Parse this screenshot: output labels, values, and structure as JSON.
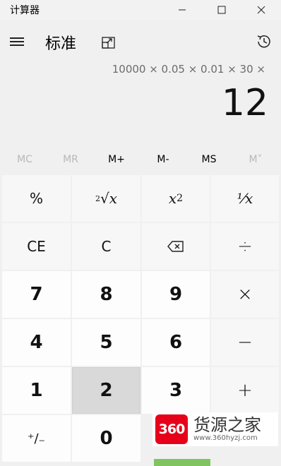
{
  "window": {
    "title": "计算器",
    "controls": {
      "minimize_icon": "minimize-icon",
      "maximize_icon": "maximize-icon",
      "close_icon": "close-icon"
    }
  },
  "header": {
    "menu_icon": "hamburger-icon",
    "mode": "标准",
    "keep_on_top_icon": "keep-on-top-icon",
    "history_icon": "history-icon"
  },
  "display": {
    "expression": "10000 × 0.05 × 0.01 × 30 ×",
    "result": "12"
  },
  "memory": [
    {
      "label": "MC",
      "enabled": false
    },
    {
      "label": "MR",
      "enabled": false
    },
    {
      "label": "M+",
      "enabled": true
    },
    {
      "label": "M-",
      "enabled": true
    },
    {
      "label": "MS",
      "enabled": true
    },
    {
      "label": "M˅",
      "enabled": false
    }
  ],
  "keys": {
    "percent": "%",
    "sqrt_index": "2",
    "sqrt_var": "x",
    "square_base": "x",
    "square_exp": "2",
    "reciprocal": "⅟x",
    "ce": "CE",
    "c": "C",
    "backspace_icon": "backspace-icon",
    "divide": "÷",
    "n7": "7",
    "n8": "8",
    "n9": "9",
    "multiply": "×",
    "n4": "4",
    "n5": "5",
    "n6": "6",
    "minus": "−",
    "n1": "1",
    "n2": "2",
    "n3": "3",
    "plus": "+",
    "negate": "⁺∕₋",
    "n0": "0"
  },
  "pressed_key": "2",
  "watermark": {
    "badge": "360",
    "brand": "货源之家",
    "url": "www.360hyzj.com"
  },
  "colors": {
    "background": "#f0f0f0",
    "number_key": "#fdfdfd",
    "function_key": "#f7f7f7",
    "pressed_key": "#d9d9d9",
    "watermark_red": "#e6001a"
  }
}
